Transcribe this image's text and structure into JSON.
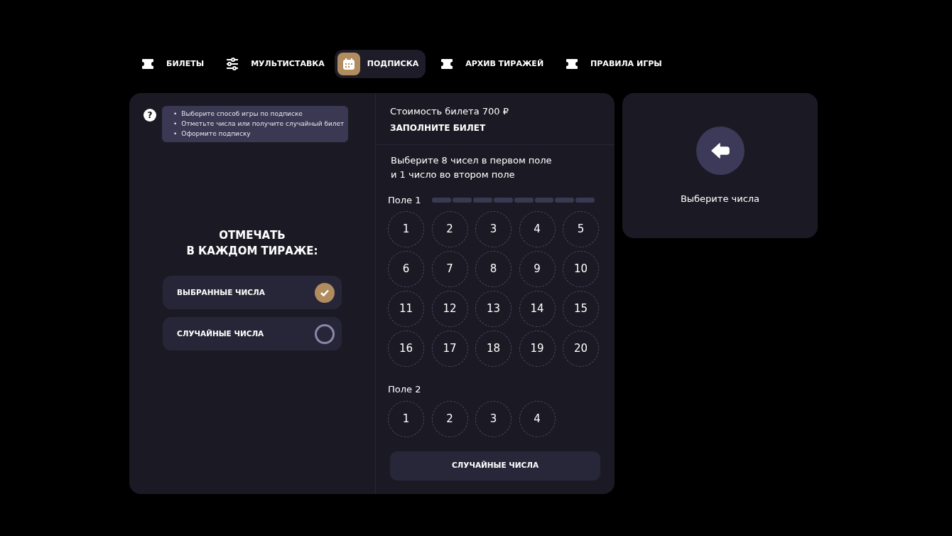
{
  "tabs": [
    {
      "label": "БИЛЕТЫ",
      "kind": "ticket",
      "selected": false
    },
    {
      "label": "МУЛЬТИСТАВКА",
      "kind": "sliders",
      "selected": false
    },
    {
      "label": "ПОДПИСКА",
      "kind": "calendar",
      "selected": true
    },
    {
      "label": "АРХИВ ТИРАЖЕЙ",
      "kind": "ticket",
      "selected": false
    },
    {
      "label": "ПРАВИЛА ИГРЫ",
      "kind": "ticket",
      "selected": false
    }
  ],
  "help": {
    "icon": "?",
    "marker": "•",
    "tips": [
      "Выберите способ игры по подписке",
      "Отметьте числа или получите случайный билет",
      "Оформите подписку"
    ]
  },
  "mark_title": [
    "ОТМЕЧАТЬ",
    "В КАЖДОМ ТИРАЖЕ:"
  ],
  "options": [
    {
      "label": "ВЫБРАННЫЕ ЧИСЛА",
      "selected": true
    },
    {
      "label": "СЛУЧАЙНЫЕ ЧИСЛА",
      "selected": false
    }
  ],
  "ticket": {
    "price": "Стоимость билета 700 ₽",
    "title": "ЗАПОЛНИТЕ БИЛЕТ",
    "instructions": [
      "Выберите 8 чисел в первом поле",
      "и 1 число во втором поле"
    ],
    "field1": {
      "label": "Поле 1",
      "progress": [
        {
          "filled": false
        },
        {
          "filled": false
        },
        {
          "filled": false
        },
        {
          "filled": false
        },
        {
          "filled": false
        },
        {
          "filled": false
        },
        {
          "filled": false
        },
        {
          "filled": false
        }
      ],
      "numbers": [
        {
          "n": "1",
          "selected": false
        },
        {
          "n": "2",
          "selected": false
        },
        {
          "n": "3",
          "selected": false
        },
        {
          "n": "4",
          "selected": false
        },
        {
          "n": "5",
          "selected": false
        },
        {
          "n": "6",
          "selected": false
        },
        {
          "n": "7",
          "selected": false
        },
        {
          "n": "8",
          "selected": false
        },
        {
          "n": "9",
          "selected": false
        },
        {
          "n": "10",
          "selected": false
        },
        {
          "n": "11",
          "selected": false
        },
        {
          "n": "12",
          "selected": false
        },
        {
          "n": "13",
          "selected": false
        },
        {
          "n": "14",
          "selected": false
        },
        {
          "n": "15",
          "selected": false
        },
        {
          "n": "16",
          "selected": false
        },
        {
          "n": "17",
          "selected": false
        },
        {
          "n": "18",
          "selected": false
        },
        {
          "n": "19",
          "selected": false
        },
        {
          "n": "20",
          "selected": false
        }
      ]
    },
    "field2": {
      "label": "Поле 2",
      "numbers": [
        {
          "n": "1",
          "selected": false
        },
        {
          "n": "2",
          "selected": false
        },
        {
          "n": "3",
          "selected": false
        },
        {
          "n": "4",
          "selected": false
        }
      ]
    },
    "random_button": "СЛУЧАЙНЫЕ ЧИСЛА"
  },
  "summary": {
    "message": "Выберите числа"
  }
}
